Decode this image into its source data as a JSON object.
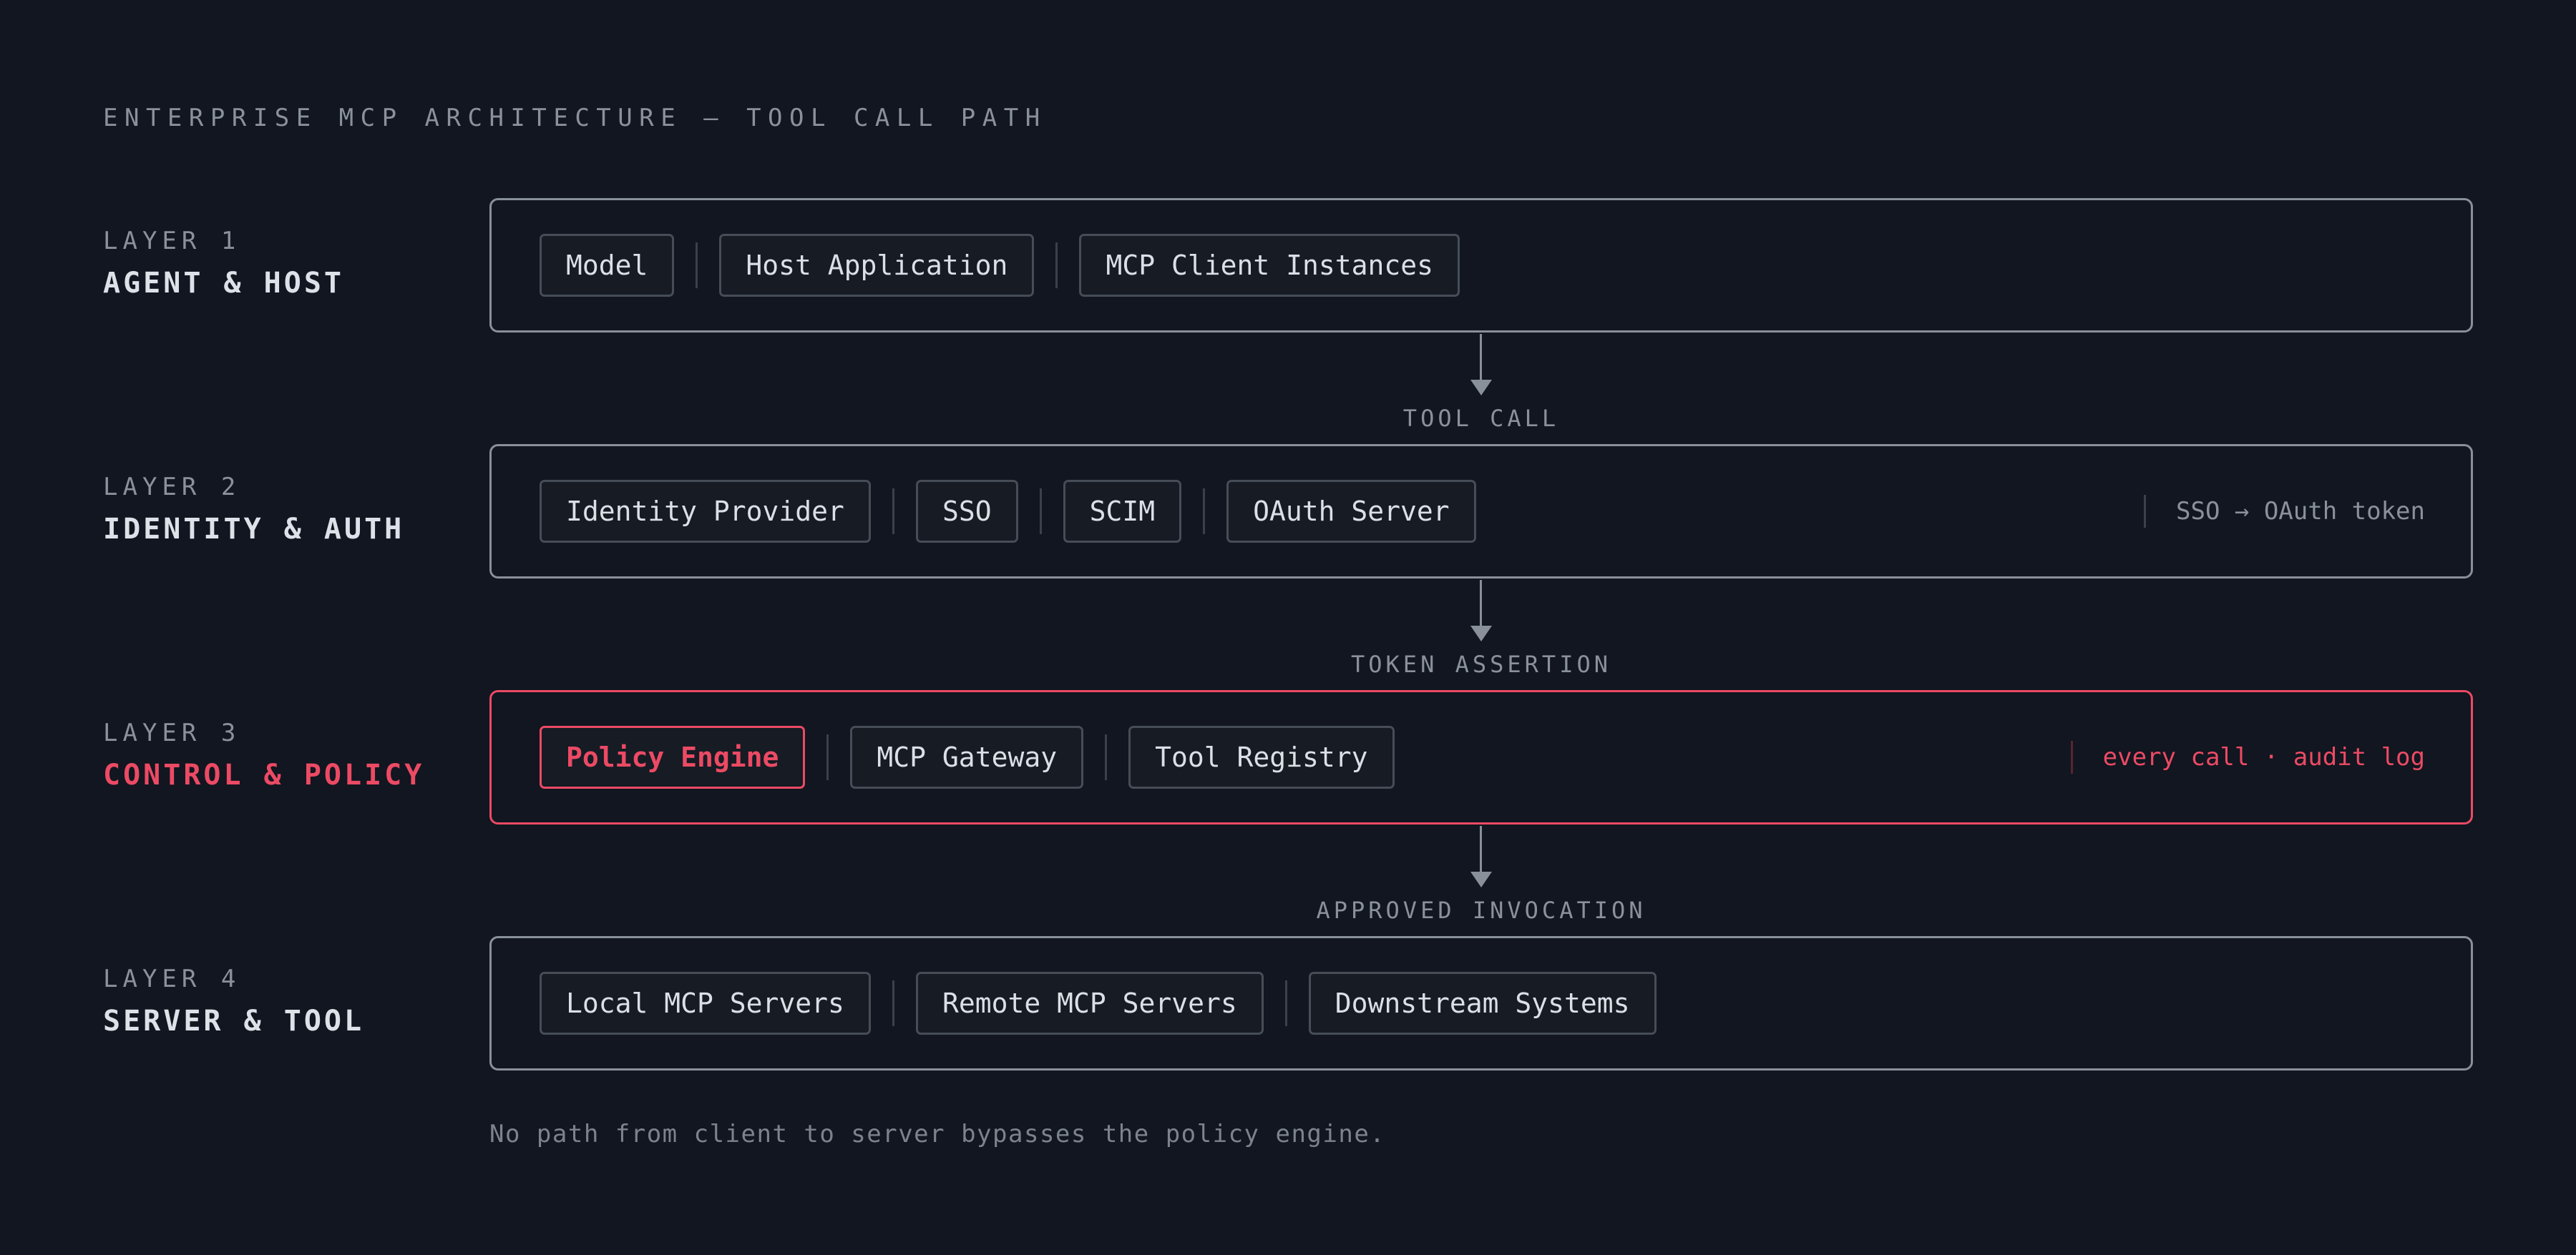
{
  "title": "ENTERPRISE MCP ARCHITECTURE — TOOL CALL PATH",
  "colors": {
    "background": "#111620",
    "accent": "#ec4a64",
    "muted_text": "#8b919b",
    "border": "#8a9099"
  },
  "layers": [
    {
      "num": "LAYER 1",
      "name": "AGENT & HOST",
      "components": [
        "Model",
        "Host Application",
        "MCP Client Instances"
      ],
      "note": ""
    },
    {
      "num": "LAYER 2",
      "name": "IDENTITY & AUTH",
      "components": [
        "Identity Provider",
        "SSO",
        "SCIM",
        "OAuth Server"
      ],
      "note": "SSO → OAuth token"
    },
    {
      "num": "LAYER 3",
      "name": "CONTROL & POLICY",
      "components": [
        "Policy Engine",
        "MCP Gateway",
        "Tool Registry"
      ],
      "note": "every call · audit log",
      "highlighted": true
    },
    {
      "num": "LAYER 4",
      "name": "SERVER & TOOL",
      "components": [
        "Local MCP Servers",
        "Remote MCP Servers",
        "Downstream Systems"
      ],
      "note": ""
    }
  ],
  "edges": [
    {
      "from": "LAYER 1",
      "to": "LAYER 2",
      "label": "TOOL CALL"
    },
    {
      "from": "LAYER 2",
      "to": "LAYER 3",
      "label": "TOKEN ASSERTION"
    },
    {
      "from": "LAYER 3",
      "to": "LAYER 4",
      "label": "APPROVED INVOCATION"
    }
  ],
  "footer": "No path from client to server bypasses the policy engine."
}
